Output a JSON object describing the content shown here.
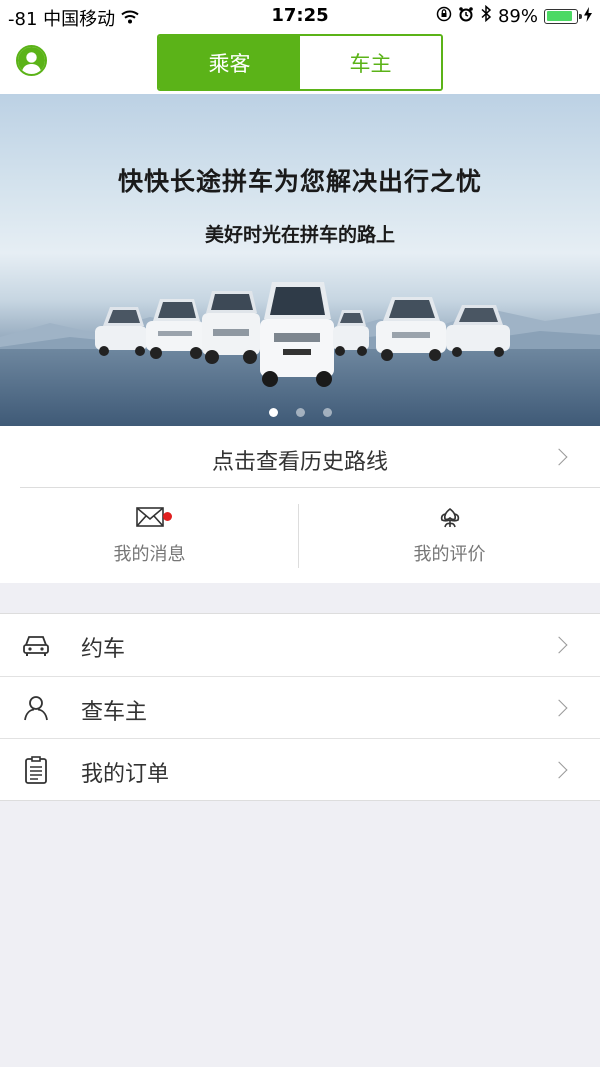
{
  "status_bar": {
    "carrier": "-81 中国移动",
    "time": "17:25",
    "battery": "89%",
    "battery_level": 0.89
  },
  "nav": {
    "tabs": [
      {
        "label": "乘客",
        "active": true
      },
      {
        "label": "车主",
        "active": false
      }
    ]
  },
  "banner": {
    "title": "快快长途拼车为您解决出行之忧",
    "subtitle": "美好时光在拼车的路上",
    "page_count": 3,
    "active_index": 0
  },
  "history": {
    "label": "点击查看历史路线"
  },
  "quick_actions": [
    {
      "label": "我的消息",
      "icon": "envelope-icon",
      "badge": true
    },
    {
      "label": "我的评价",
      "icon": "flower-icon",
      "badge": false
    }
  ],
  "menu": [
    {
      "label": "约车",
      "icon": "car-icon"
    },
    {
      "label": "查车主",
      "icon": "person-icon"
    },
    {
      "label": "我的订单",
      "icon": "clipboard-icon"
    }
  ],
  "colors": {
    "accent": "#5bb318",
    "badge": "#e02020",
    "background": "#efeff4"
  }
}
